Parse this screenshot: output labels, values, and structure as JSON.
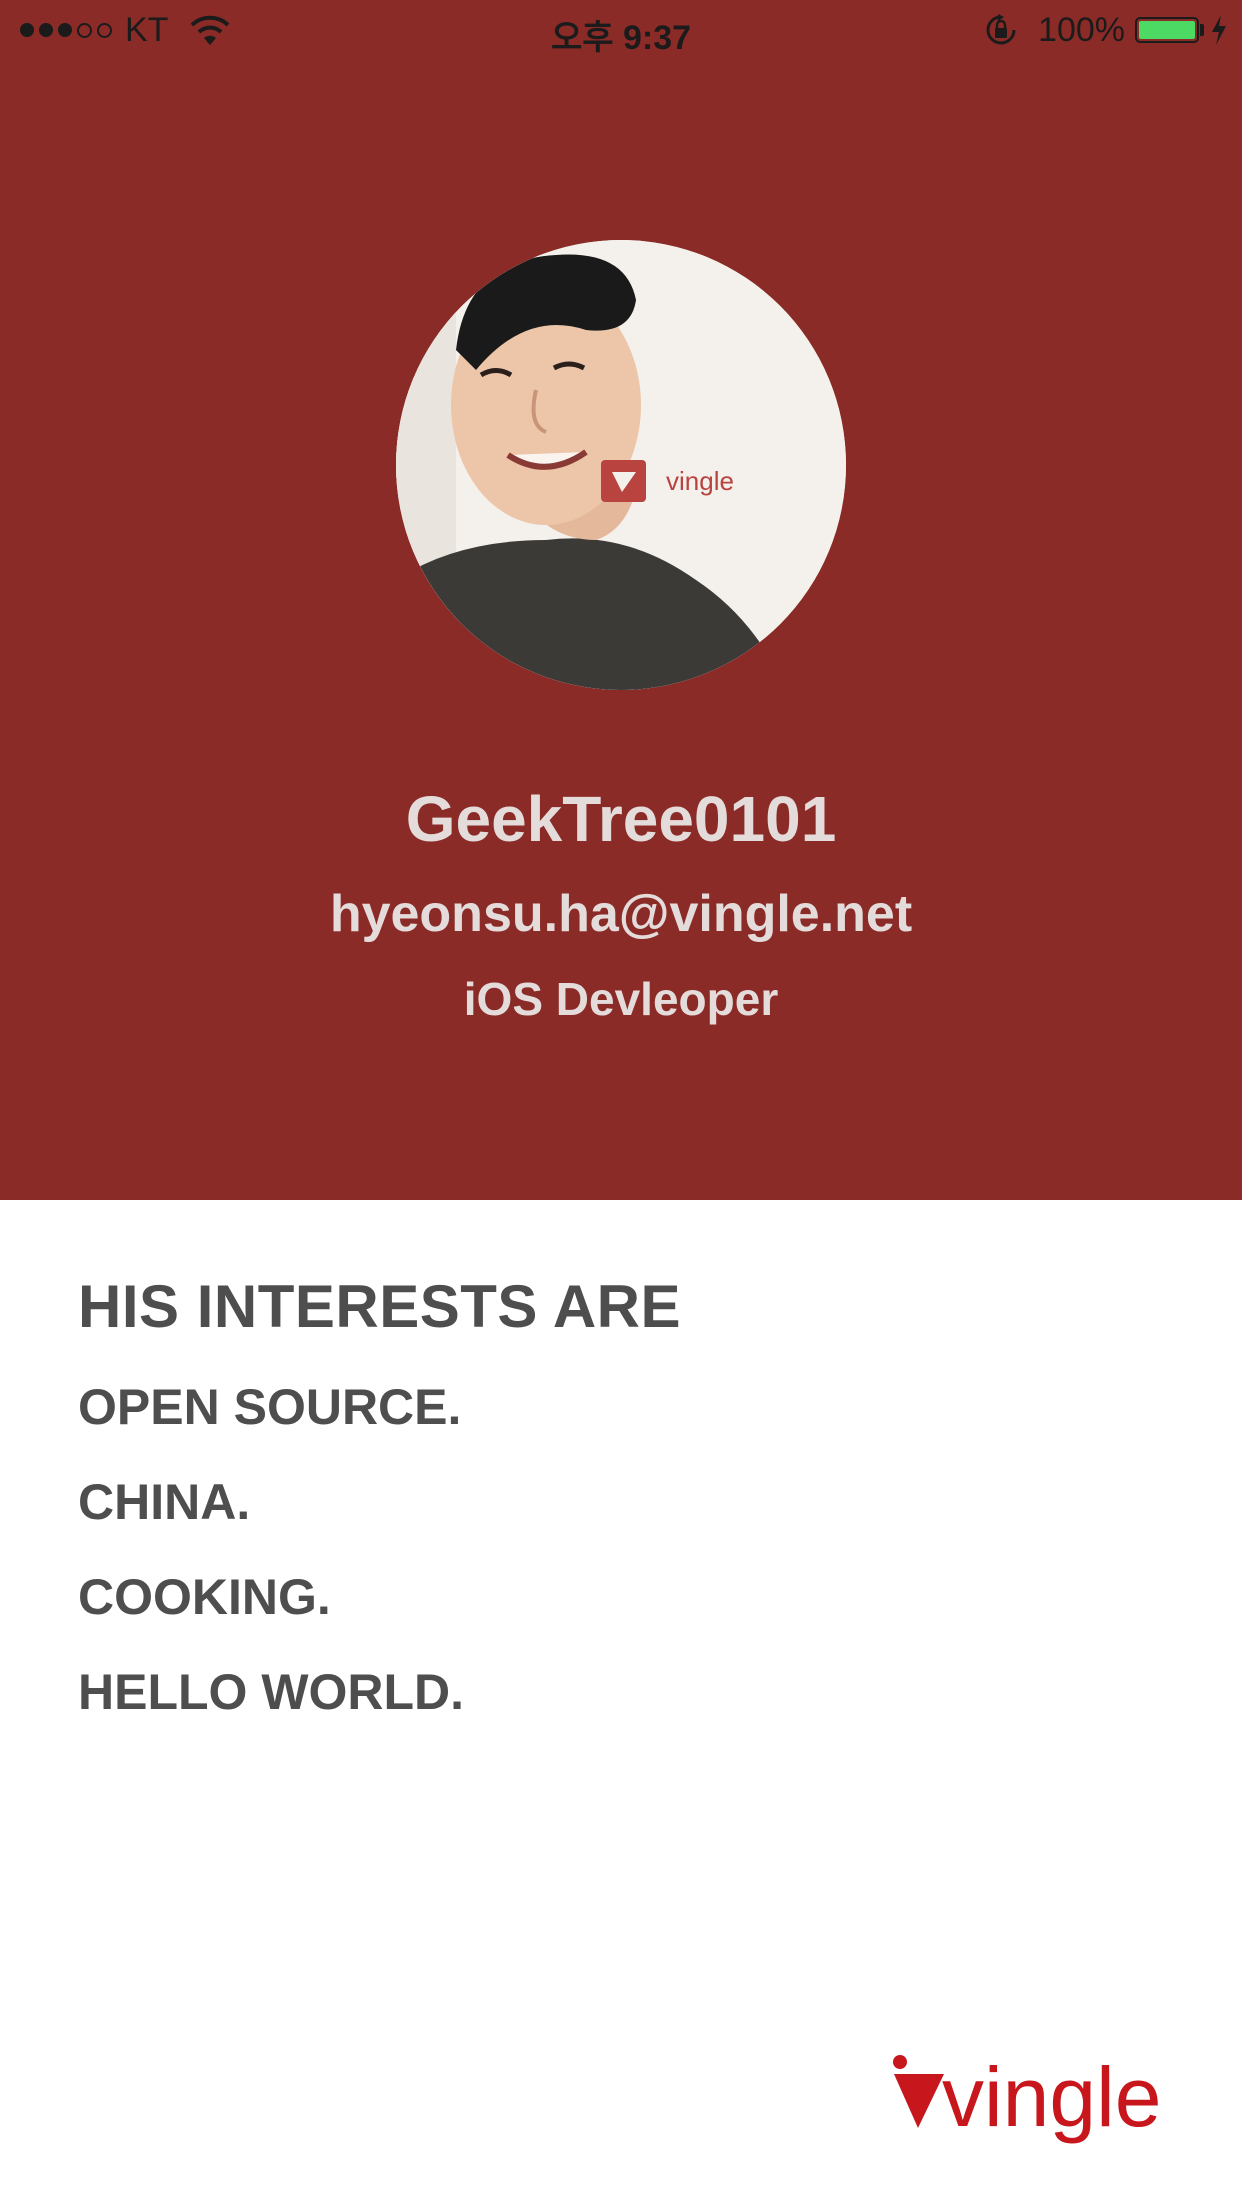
{
  "status_bar": {
    "carrier": "KT",
    "time": "오후 9:37",
    "battery_percent": "100%",
    "signal_filled": 3,
    "signal_total": 5
  },
  "profile": {
    "avatar_icon": "profile-photo",
    "name": "GeekTree0101",
    "email": "hyeonsu.ha@vingle.net",
    "role": "iOS Devleoper"
  },
  "interests": {
    "title": "HIS INTERESTS ARE",
    "items": [
      "OPEN SOURCE.",
      "CHINA.",
      "COOKING.",
      "HELLO WORLD."
    ]
  },
  "brand": {
    "logo_text": "vingle",
    "color": "#c8161d"
  },
  "colors": {
    "header_bg": "#8b2b27",
    "header_text": "#e4dcdb",
    "body_text": "#4e4e4e"
  }
}
